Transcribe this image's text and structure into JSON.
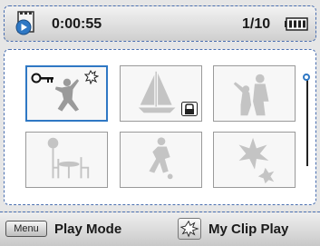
{
  "header": {
    "time": "0:00:55",
    "count": "1/10",
    "icon": "video-playback-icon",
    "battery": "battery-full-icon"
  },
  "thumbnails": [
    {
      "subject": "dancer-silhouette",
      "selected": true,
      "protected": true,
      "my_clip": true
    },
    {
      "subject": "sailboat-silhouette",
      "selected": false,
      "locked": true
    },
    {
      "subject": "father-and-child-silhouette",
      "selected": false
    },
    {
      "subject": "cafe-table-silhouette",
      "selected": false
    },
    {
      "subject": "soccer-player-silhouette",
      "selected": false
    },
    {
      "subject": "flower-silhouette",
      "selected": false
    }
  ],
  "footer": {
    "menu_label": "Menu",
    "play_mode_label": "Play Mode",
    "my_clip_label": "My Clip Play"
  },
  "colors": {
    "accent": "#2f78c4",
    "border_dashed": "#4a6fb0",
    "silhouette": "#bdbdbd",
    "selected_silhouette": "#999999"
  }
}
